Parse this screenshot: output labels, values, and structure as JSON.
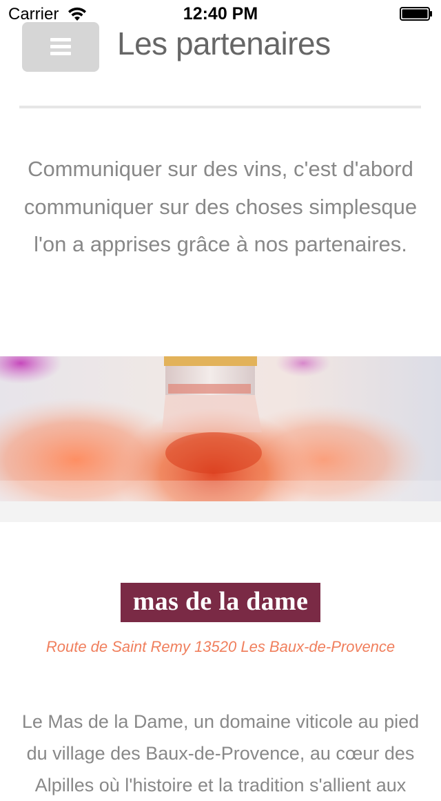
{
  "status_bar": {
    "carrier": "Carrier",
    "time": "12:40 PM"
  },
  "header": {
    "menu_icon": "hamburger-icon",
    "title": "Les partenaires"
  },
  "intro": {
    "text": "Communiquer sur des vins, c'est d'abord communiquer sur des choses simplesque l'on a apprises grâce à nos partenaires."
  },
  "hero": {
    "image": "rosé wine bottles photo"
  },
  "partner": {
    "logo_text": "mas de la dame",
    "logo_color": "#7a2a45",
    "address": "Route de Saint Remy 13520 Les Baux-de-Provence",
    "address_color": "#f07f5d",
    "description": "Le Mas de la Dame, un domaine viticole au pied du village des Baux-de-Provence, au cœur des Alpilles où l'histoire et la tradition s'allient aux"
  }
}
